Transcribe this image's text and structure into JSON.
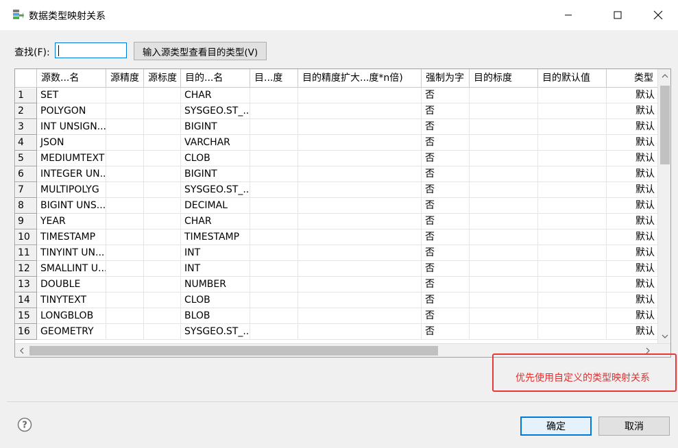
{
  "window": {
    "title": "数据类型映射关系",
    "icon": "database-mapping-icon"
  },
  "find": {
    "label": "查找(F):",
    "value": "",
    "lookup_button": "输入源类型查看目的类型(V)"
  },
  "table": {
    "columns": [
      "源数...名",
      "源精度",
      "源标度",
      "目的...名",
      "目...度",
      "目的精度扩大...度*n倍)",
      "强制为字",
      "目的标度",
      "目的默认值",
      "类型"
    ],
    "rows": [
      {
        "num": "1",
        "src": "SET",
        "dst": "CHAR",
        "force": "否",
        "type": "默认"
      },
      {
        "num": "2",
        "src": "POLYGON",
        "dst": "SYSGEO.ST_...",
        "force": "否",
        "type": "默认"
      },
      {
        "num": "3",
        "src": "INT UNSIGN...",
        "dst": "BIGINT",
        "force": "否",
        "type": "默认"
      },
      {
        "num": "4",
        "src": "JSON",
        "dst": "VARCHAR",
        "force": "否",
        "type": "默认"
      },
      {
        "num": "5",
        "src": "MEDIUMTEXT",
        "dst": "CLOB",
        "force": "否",
        "type": "默认"
      },
      {
        "num": "6",
        "src": "INTEGER UN...",
        "dst": "BIGINT",
        "force": "否",
        "type": "默认"
      },
      {
        "num": "7",
        "src": "MULTIPOLYG",
        "dst": "SYSGEO.ST_...",
        "force": "否",
        "type": "默认"
      },
      {
        "num": "8",
        "src": "BIGINT UNS...",
        "dst": "DECIMAL",
        "force": "否",
        "type": "默认"
      },
      {
        "num": "9",
        "src": "YEAR",
        "dst": "CHAR",
        "force": "否",
        "type": "默认"
      },
      {
        "num": "10",
        "src": "TIMESTAMP",
        "dst": "TIMESTAMP",
        "force": "否",
        "type": "默认"
      },
      {
        "num": "11",
        "src": "TINYINT UN...",
        "dst": "INT",
        "force": "否",
        "type": "默认"
      },
      {
        "num": "12",
        "src": "SMALLINT U...",
        "dst": "INT",
        "force": "否",
        "type": "默认"
      },
      {
        "num": "13",
        "src": "DOUBLE",
        "dst": "NUMBER",
        "force": "否",
        "type": "默认"
      },
      {
        "num": "14",
        "src": "TINYTEXT",
        "dst": "CLOB",
        "force": "否",
        "type": "默认"
      },
      {
        "num": "15",
        "src": "LONGBLOB",
        "dst": "BLOB",
        "force": "否",
        "type": "默认"
      },
      {
        "num": "16",
        "src": "GEOMETRY",
        "dst": "SYSGEO.ST_...",
        "force": "否",
        "type": "默认"
      }
    ]
  },
  "note": "优先使用自定义的类型映射关系",
  "buttons": {
    "ok": "确定",
    "cancel": "取消"
  },
  "colors": {
    "accent": "#0078d7",
    "note": "#e53935"
  }
}
